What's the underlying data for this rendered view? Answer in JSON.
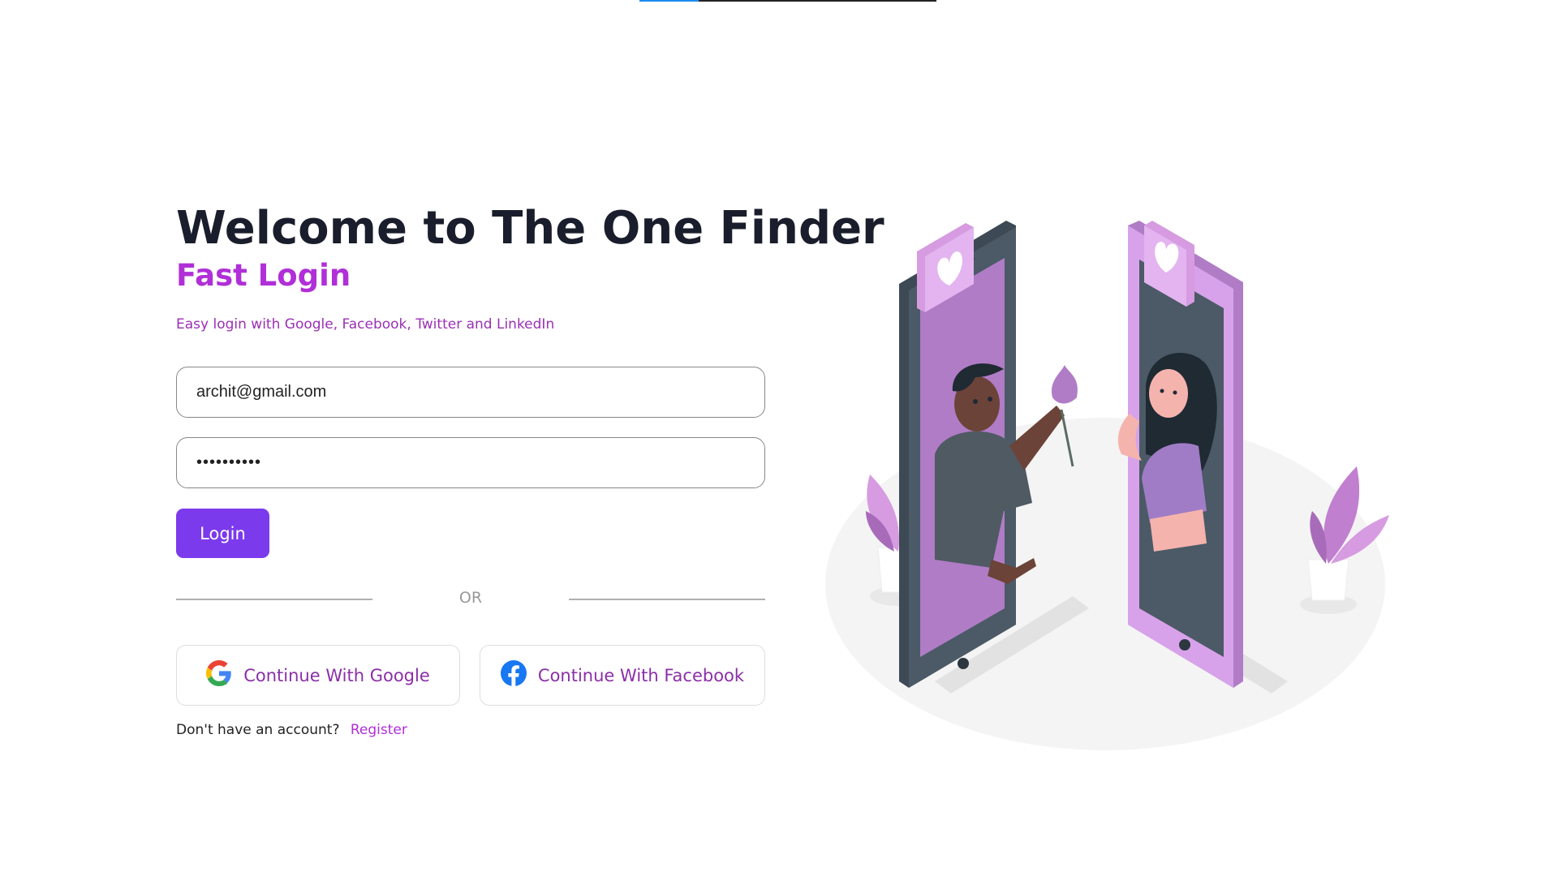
{
  "loading_bar": {
    "progress": 0.2,
    "color": "#1d8cf0"
  },
  "header": {
    "title": "Welcome to The One Finder",
    "subtitle": "Fast Login",
    "description": "Easy login with Google, Facebook, Twitter and LinkedIn"
  },
  "form": {
    "email_value": "archit@gmail.com",
    "password_value": "••••••••••",
    "login_label": "Login",
    "or_label": "OR"
  },
  "social": {
    "google_label": "Continue With Google",
    "facebook_label": "Continue With Facebook"
  },
  "register": {
    "prompt": "Don't have an account?",
    "link_label": "Register"
  },
  "icons": {
    "google": "google-icon",
    "facebook": "facebook-icon"
  },
  "colors": {
    "accent": "#7c3aed",
    "brand_purple": "#b02fd8",
    "heading": "#1a1d2b"
  }
}
